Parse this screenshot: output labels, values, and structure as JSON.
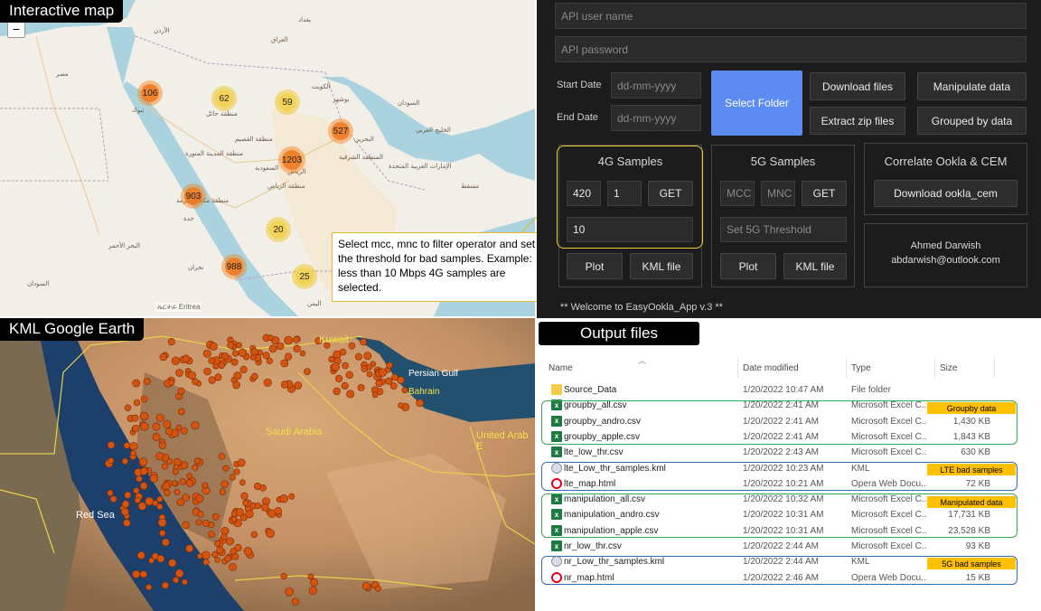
{
  "map": {
    "title": "Interactive map",
    "zoom_out": "−",
    "attribution": "ኤርትራ Eritrea",
    "clusters": [
      {
        "label": "106",
        "color": "orange"
      },
      {
        "label": "62",
        "color": "yellow"
      },
      {
        "label": "59",
        "color": "yellow"
      },
      {
        "label": "527",
        "color": "orange"
      },
      {
        "label": "1203",
        "color": "orange"
      },
      {
        "label": "903",
        "color": "orange"
      },
      {
        "label": "20",
        "color": "yellow"
      },
      {
        "label": "988",
        "color": "orange"
      },
      {
        "label": "25",
        "color": "yellow"
      }
    ],
    "places": [
      "الرياض",
      "السعودية",
      "جدة",
      "تبوك",
      "الكويت",
      "مصر",
      "الأردن",
      "العراق",
      "البحرين",
      "الإمارات العربية المتحدة",
      "منطقة حائل",
      "منطقة القصيم",
      "منطقة المدينة المنورة",
      "المنطقة الشرقية",
      "منطقة الرياض",
      "منطقة مكة المكرمة",
      "نجران",
      "السودان",
      "البحر الأحمر",
      "الخليج العربي",
      "مسقط",
      "اليمن",
      "بغداد",
      "بوشهر"
    ]
  },
  "callout": {
    "text": "Select mcc, mnc to filter operator and set the threshold for bad samples. Example: less than 10 Mbps 4G samples are selected."
  },
  "app": {
    "api_user_placeholder": "API user name",
    "api_password_placeholder": "API password",
    "start_date_label": "Start Date",
    "end_date_label": "End Date",
    "date_placeholder": "dd-mm-yyyy",
    "select_folder": "Select Folder",
    "download_files": "Download files",
    "manipulate_data": "Manipulate data",
    "extract_zip": "Extract zip files",
    "grouped_by": "Grouped by data",
    "g4": {
      "title": "4G Samples",
      "mcc": "420",
      "mnc": "1",
      "get": "GET",
      "threshold": "10",
      "plot": "Plot",
      "kml": "KML file"
    },
    "g5": {
      "title": "5G Samples",
      "mcc": "MCC",
      "mnc": "MNC",
      "get": "GET",
      "threshold": "Set 5G Threshold",
      "plot": "Plot",
      "kml": "KML file"
    },
    "correlate_title": "Correlate Ookla & CEM",
    "download_ookla": "Download ookla_cem",
    "author": "Ahmed Darwish",
    "email": "abdarwish@outlook.com",
    "welcome": "** Welcome to EasyOokla_App v.3 **"
  },
  "kml": {
    "title": "KML Google Earth",
    "labels": [
      "Kuwait",
      "Persian Gulf",
      "Bahrain",
      "Saudi Arabia",
      "United Arab E",
      "Red Sea"
    ]
  },
  "files": {
    "title": "Output files",
    "columns": [
      "Name",
      "Date modified",
      "Type",
      "Size"
    ],
    "rows": [
      {
        "name": "Source_Data",
        "date": "1/20/2022 10:47 AM",
        "type": "File folder",
        "size": "",
        "icon": "folder"
      },
      {
        "name": "groupby_all.csv",
        "date": "1/20/2022 2:41 AM",
        "type": "Microsoft Excel C...",
        "size": "",
        "icon": "excel"
      },
      {
        "name": "groupby_andro.csv",
        "date": "1/20/2022 2:41 AM",
        "type": "Microsoft Excel C...",
        "size": "1,430 KB",
        "icon": "excel"
      },
      {
        "name": "groupby_apple.csv",
        "date": "1/20/2022 2:41 AM",
        "type": "Microsoft Excel C...",
        "size": "1,843 KB",
        "icon": "excel"
      },
      {
        "name": "lte_low_thr.csv",
        "date": "1/20/2022 2:43 AM",
        "type": "Microsoft Excel C...",
        "size": "630 KB",
        "icon": "excel"
      },
      {
        "name": "lte_Low_thr_samples.kml",
        "date": "1/20/2022 10:23 AM",
        "type": "KML",
        "size": "",
        "icon": "kml"
      },
      {
        "name": "lte_map.html",
        "date": "1/20/2022 10:21 AM",
        "type": "Opera Web Docu...",
        "size": "72 KB",
        "icon": "opera"
      },
      {
        "name": "manipulation_all.csv",
        "date": "1/20/2022 10:32 AM",
        "type": "Microsoft Excel C...",
        "size": "",
        "icon": "excel"
      },
      {
        "name": "manipulation_andro.csv",
        "date": "1/20/2022 10:31 AM",
        "type": "Microsoft Excel C...",
        "size": "17,731 KB",
        "icon": "excel"
      },
      {
        "name": "manipulation_apple.csv",
        "date": "1/20/2022 10:31 AM",
        "type": "Microsoft Excel C...",
        "size": "23,528 KB",
        "icon": "excel"
      },
      {
        "name": "nr_low_thr.csv",
        "date": "1/20/2022 2:44 AM",
        "type": "Microsoft Excel C...",
        "size": "93 KB",
        "icon": "excel"
      },
      {
        "name": "nr_Low_thr_samples.kml",
        "date": "1/20/2022 2:44 AM",
        "type": "KML",
        "size": "",
        "icon": "kml"
      },
      {
        "name": "nr_map.html",
        "date": "1/20/2022 2:46 AM",
        "type": "Opera Web Docu...",
        "size": "15 KB",
        "icon": "opera"
      }
    ],
    "tags": [
      "Groupby data",
      "LTE bad samples",
      "Manipulated data",
      "5G bad samples"
    ],
    "colors": {
      "green_group": "#3aa757",
      "blue_group": "#2f6db5",
      "tag": "#ffc000"
    }
  }
}
